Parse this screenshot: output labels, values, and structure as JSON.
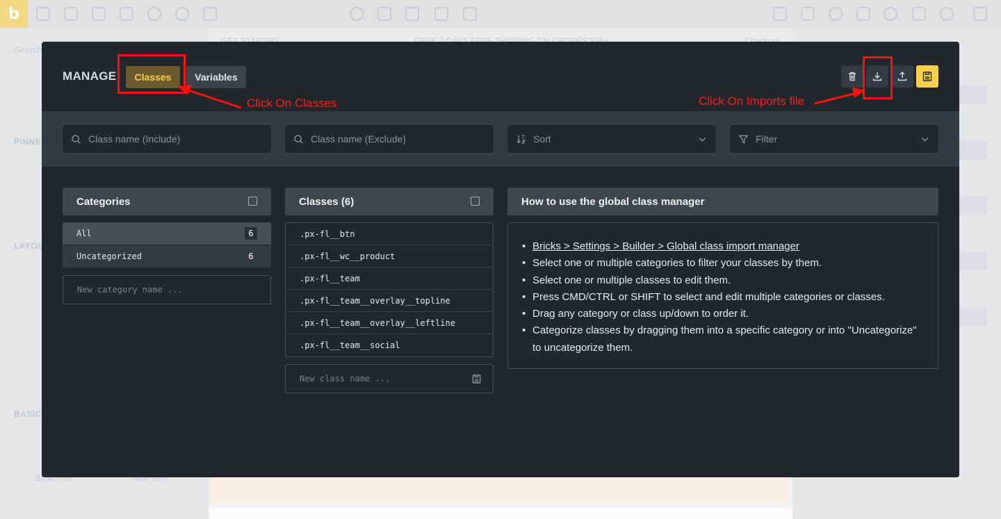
{
  "builder": {
    "logo": "b",
    "left_panel": {
      "search_placeholder": "Search",
      "sections": [
        "PINNED",
        "LAYOUT",
        "BASIC"
      ],
      "items": [
        "Basic Text",
        "Rich Text"
      ]
    },
    "canvas": {
      "topbar_left": "GET STARTED",
      "topbar_center": "FREE 2-DAYS FREE SHIPPING ON ORDERS $35+",
      "topbar_right": "Checkout"
    }
  },
  "modal": {
    "title": "MANAGE",
    "tabs": {
      "classes": "Classes",
      "variables": "Variables"
    },
    "header_buttons": {
      "delete": "trash-icon",
      "import": "download-icon",
      "export": "upload-icon",
      "save": "save-icon"
    },
    "filters": {
      "include_placeholder": "Class name (Include)",
      "exclude_placeholder": "Class name (Exclude)",
      "sort_label": "Sort",
      "filter_label": "Filter"
    },
    "categories": {
      "title": "Categories",
      "items": [
        {
          "name": "All",
          "count": "6"
        },
        {
          "name": "Uncategorized",
          "count": "6"
        }
      ],
      "new_placeholder": "New category name ..."
    },
    "classes": {
      "title": "Classes (6)",
      "items": [
        ".px-fl__btn",
        ".px-fl__wc__product",
        ".px-fl__team",
        ".px-fl__team__overlay__topline",
        ".px-fl__team__overlay__leftline",
        ".px-fl__team__social"
      ],
      "new_placeholder": "New class name ..."
    },
    "help": {
      "title": "How to use the global class manager",
      "link": "Bricks > Settings > Builder > Global class import manager",
      "items": [
        "Select one or multiple categories to filter your classes by them.",
        "Select one or multiple classes to edit them.",
        "Press CMD/CTRL or SHIFT to select and edit multiple categories or classes.",
        "Drag any category or class up/down to order it.",
        "Categorize classes by dragging them into a specific category or into \"Uncategorize\" to uncategorize them."
      ]
    }
  },
  "annotations": {
    "classes_note": "Click On Classes",
    "import_note": "Click On Imports file"
  },
  "colors": {
    "modal_bg": "#23272b",
    "accent": "#f7d04a",
    "annotation": "#ff1010"
  }
}
